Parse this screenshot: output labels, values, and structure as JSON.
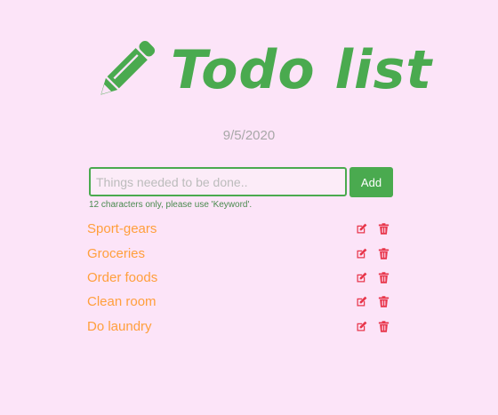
{
  "app": {
    "title": "Todo list",
    "date": "9/5/2020"
  },
  "form": {
    "placeholder": "Things needed to be done..",
    "value": "",
    "add_label": "Add",
    "hint": "12 characters only, please use 'Keyword'."
  },
  "todos": [
    {
      "text": "Sport-gears",
      "edit_icon": "edit-icon",
      "delete_icon": "trash-icon"
    },
    {
      "text": "Groceries",
      "edit_icon": "edit-icon",
      "delete_icon": "trash-icon"
    },
    {
      "text": "Order foods",
      "edit_icon": "edit-icon",
      "delete_icon": "trash-icon"
    },
    {
      "text": "Clean room",
      "edit_icon": "edit-icon",
      "delete_icon": "trash-icon"
    },
    {
      "text": "Do laundry",
      "edit_icon": "edit-icon",
      "delete_icon": "trash-icon"
    }
  ],
  "colors": {
    "background": "#fce4f8",
    "accent": "#4aaa4f",
    "item_text": "#ff9f3c",
    "icon": "#e8364b",
    "date": "#a8a8a8"
  }
}
